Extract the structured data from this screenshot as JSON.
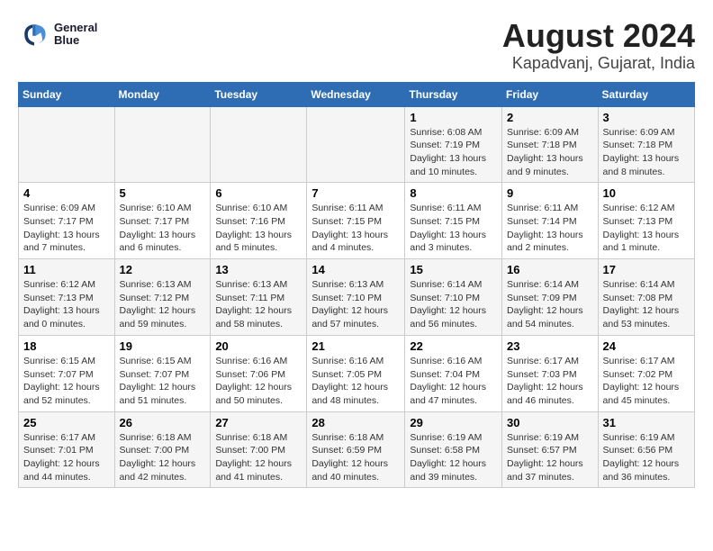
{
  "header": {
    "logo_line1": "General",
    "logo_line2": "Blue",
    "title": "August 2024",
    "subtitle": "Kapadvanj, Gujarat, India"
  },
  "days_of_week": [
    "Sunday",
    "Monday",
    "Tuesday",
    "Wednesday",
    "Thursday",
    "Friday",
    "Saturday"
  ],
  "weeks": [
    [
      {
        "day": "",
        "info": ""
      },
      {
        "day": "",
        "info": ""
      },
      {
        "day": "",
        "info": ""
      },
      {
        "day": "",
        "info": ""
      },
      {
        "day": "1",
        "info": "Sunrise: 6:08 AM\nSunset: 7:19 PM\nDaylight: 13 hours\nand 10 minutes."
      },
      {
        "day": "2",
        "info": "Sunrise: 6:09 AM\nSunset: 7:18 PM\nDaylight: 13 hours\nand 9 minutes."
      },
      {
        "day": "3",
        "info": "Sunrise: 6:09 AM\nSunset: 7:18 PM\nDaylight: 13 hours\nand 8 minutes."
      }
    ],
    [
      {
        "day": "4",
        "info": "Sunrise: 6:09 AM\nSunset: 7:17 PM\nDaylight: 13 hours\nand 7 minutes."
      },
      {
        "day": "5",
        "info": "Sunrise: 6:10 AM\nSunset: 7:17 PM\nDaylight: 13 hours\nand 6 minutes."
      },
      {
        "day": "6",
        "info": "Sunrise: 6:10 AM\nSunset: 7:16 PM\nDaylight: 13 hours\nand 5 minutes."
      },
      {
        "day": "7",
        "info": "Sunrise: 6:11 AM\nSunset: 7:15 PM\nDaylight: 13 hours\nand 4 minutes."
      },
      {
        "day": "8",
        "info": "Sunrise: 6:11 AM\nSunset: 7:15 PM\nDaylight: 13 hours\nand 3 minutes."
      },
      {
        "day": "9",
        "info": "Sunrise: 6:11 AM\nSunset: 7:14 PM\nDaylight: 13 hours\nand 2 minutes."
      },
      {
        "day": "10",
        "info": "Sunrise: 6:12 AM\nSunset: 7:13 PM\nDaylight: 13 hours\nand 1 minute."
      }
    ],
    [
      {
        "day": "11",
        "info": "Sunrise: 6:12 AM\nSunset: 7:13 PM\nDaylight: 13 hours\nand 0 minutes."
      },
      {
        "day": "12",
        "info": "Sunrise: 6:13 AM\nSunset: 7:12 PM\nDaylight: 12 hours\nand 59 minutes."
      },
      {
        "day": "13",
        "info": "Sunrise: 6:13 AM\nSunset: 7:11 PM\nDaylight: 12 hours\nand 58 minutes."
      },
      {
        "day": "14",
        "info": "Sunrise: 6:13 AM\nSunset: 7:10 PM\nDaylight: 12 hours\nand 57 minutes."
      },
      {
        "day": "15",
        "info": "Sunrise: 6:14 AM\nSunset: 7:10 PM\nDaylight: 12 hours\nand 56 minutes."
      },
      {
        "day": "16",
        "info": "Sunrise: 6:14 AM\nSunset: 7:09 PM\nDaylight: 12 hours\nand 54 minutes."
      },
      {
        "day": "17",
        "info": "Sunrise: 6:14 AM\nSunset: 7:08 PM\nDaylight: 12 hours\nand 53 minutes."
      }
    ],
    [
      {
        "day": "18",
        "info": "Sunrise: 6:15 AM\nSunset: 7:07 PM\nDaylight: 12 hours\nand 52 minutes."
      },
      {
        "day": "19",
        "info": "Sunrise: 6:15 AM\nSunset: 7:07 PM\nDaylight: 12 hours\nand 51 minutes."
      },
      {
        "day": "20",
        "info": "Sunrise: 6:16 AM\nSunset: 7:06 PM\nDaylight: 12 hours\nand 50 minutes."
      },
      {
        "day": "21",
        "info": "Sunrise: 6:16 AM\nSunset: 7:05 PM\nDaylight: 12 hours\nand 48 minutes."
      },
      {
        "day": "22",
        "info": "Sunrise: 6:16 AM\nSunset: 7:04 PM\nDaylight: 12 hours\nand 47 minutes."
      },
      {
        "day": "23",
        "info": "Sunrise: 6:17 AM\nSunset: 7:03 PM\nDaylight: 12 hours\nand 46 minutes."
      },
      {
        "day": "24",
        "info": "Sunrise: 6:17 AM\nSunset: 7:02 PM\nDaylight: 12 hours\nand 45 minutes."
      }
    ],
    [
      {
        "day": "25",
        "info": "Sunrise: 6:17 AM\nSunset: 7:01 PM\nDaylight: 12 hours\nand 44 minutes."
      },
      {
        "day": "26",
        "info": "Sunrise: 6:18 AM\nSunset: 7:00 PM\nDaylight: 12 hours\nand 42 minutes."
      },
      {
        "day": "27",
        "info": "Sunrise: 6:18 AM\nSunset: 7:00 PM\nDaylight: 12 hours\nand 41 minutes."
      },
      {
        "day": "28",
        "info": "Sunrise: 6:18 AM\nSunset: 6:59 PM\nDaylight: 12 hours\nand 40 minutes."
      },
      {
        "day": "29",
        "info": "Sunrise: 6:19 AM\nSunset: 6:58 PM\nDaylight: 12 hours\nand 39 minutes."
      },
      {
        "day": "30",
        "info": "Sunrise: 6:19 AM\nSunset: 6:57 PM\nDaylight: 12 hours\nand 37 minutes."
      },
      {
        "day": "31",
        "info": "Sunrise: 6:19 AM\nSunset: 6:56 PM\nDaylight: 12 hours\nand 36 minutes."
      }
    ]
  ]
}
